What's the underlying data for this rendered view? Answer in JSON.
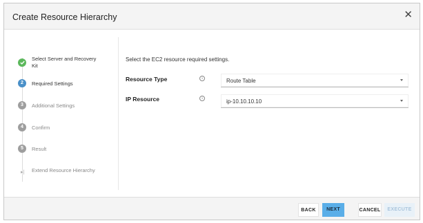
{
  "dialog": {
    "title": "Create Resource Hierarchy",
    "close_icon": "close-icon"
  },
  "steps": [
    {
      "label": "Select Server and Recovery Kit",
      "state": "done",
      "marker": "check-icon"
    },
    {
      "label": "Required Settings",
      "state": "active",
      "marker": "2"
    },
    {
      "label": "Additional Settings",
      "state": "pending",
      "marker": "3"
    },
    {
      "label": "Confirm",
      "state": "pending",
      "marker": "4"
    },
    {
      "label": "Result",
      "state": "pending",
      "marker": "5"
    },
    {
      "label": "Extend Resource Hierarchy",
      "state": "pending",
      "marker": "next-arrow-icon"
    }
  ],
  "content": {
    "intro": "Select the EC2 resource required settings.",
    "fields": [
      {
        "label": "Resource Type",
        "info_icon": "info-icon",
        "value": "Route Table"
      },
      {
        "label": "IP Resource",
        "info_icon": "info-icon",
        "value": "ip-10.10.10.10"
      }
    ]
  },
  "footer": {
    "back": "BACK",
    "next": "NEXT",
    "cancel": "CANCEL",
    "execute": "EXECUTE"
  },
  "colors": {
    "done": "#5cb85c",
    "active": "#4a90c8",
    "pending": "#9e9e9e",
    "primary_button": "#5aaee8",
    "disabled_button": "#e8f1f8"
  }
}
